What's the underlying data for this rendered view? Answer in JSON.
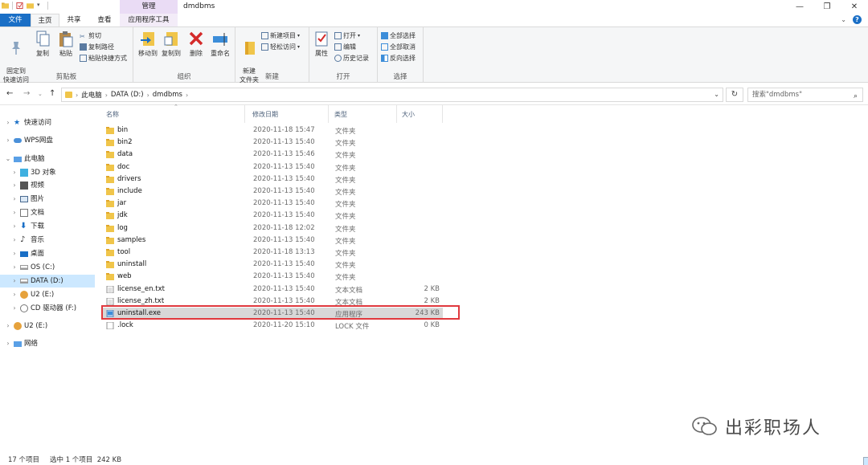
{
  "window": {
    "title": "dmdbms",
    "context_tab_header": "管理",
    "controls": [
      "—",
      "❐",
      "✕"
    ]
  },
  "tabs": {
    "file": "文件",
    "home": "主页",
    "share": "共享",
    "view": "查看",
    "app_tools": "应用程序工具"
  },
  "ribbon": {
    "clipboard": {
      "label": "剪贴板",
      "pin": "固定到\n快速访问",
      "copy": "复制",
      "paste": "粘贴",
      "cut": "剪切",
      "copy_path": "复制路径",
      "paste_shortcut": "粘贴快捷方式"
    },
    "organize": {
      "label": "组织",
      "move_to": "移动到",
      "copy_to": "复制到",
      "delete": "删除",
      "rename": "重命名"
    },
    "new": {
      "label": "新建",
      "new_folder": "新建\n文件夹",
      "new_item": "新建项目",
      "easy_access": "轻松访问"
    },
    "open": {
      "label": "打开",
      "properties": "属性",
      "open": "打开",
      "edit": "编辑",
      "history": "历史记录"
    },
    "select": {
      "label": "选择",
      "select_all": "全部选择",
      "select_none": "全部取消",
      "invert": "反向选择"
    }
  },
  "address": {
    "crumbs": [
      "此电脑",
      "DATA (D:)",
      "dmdbms"
    ],
    "search_placeholder": "搜索\"dmdbms\""
  },
  "nav": {
    "quick_access": "快速访问",
    "wps": "WPS网盘",
    "this_pc": "此电脑",
    "objects3d": "3D 对象",
    "videos": "视频",
    "pictures": "图片",
    "documents": "文档",
    "downloads": "下载",
    "music": "音乐",
    "desktop": "桌面",
    "os_c": "OS (C:)",
    "data_d": "DATA (D:)",
    "u2_e": "U2 (E:)",
    "cd_f": "CD 驱动器 (F:)",
    "u2_e2": "U2 (E:)",
    "network": "网络"
  },
  "columns": {
    "name": "名称",
    "date": "修改日期",
    "type": "类型",
    "size": "大小"
  },
  "files": [
    {
      "name": "bin",
      "date": "2020-11-18 15:47",
      "type": "文件夹",
      "size": "",
      "kind": "folder"
    },
    {
      "name": "bin2",
      "date": "2020-11-13 15:40",
      "type": "文件夹",
      "size": "",
      "kind": "folder"
    },
    {
      "name": "data",
      "date": "2020-11-13 15:46",
      "type": "文件夹",
      "size": "",
      "kind": "folder"
    },
    {
      "name": "doc",
      "date": "2020-11-13 15:40",
      "type": "文件夹",
      "size": "",
      "kind": "folder"
    },
    {
      "name": "drivers",
      "date": "2020-11-13 15:40",
      "type": "文件夹",
      "size": "",
      "kind": "folder"
    },
    {
      "name": "include",
      "date": "2020-11-13 15:40",
      "type": "文件夹",
      "size": "",
      "kind": "folder"
    },
    {
      "name": "jar",
      "date": "2020-11-13 15:40",
      "type": "文件夹",
      "size": "",
      "kind": "folder"
    },
    {
      "name": "jdk",
      "date": "2020-11-13 15:40",
      "type": "文件夹",
      "size": "",
      "kind": "folder"
    },
    {
      "name": "log",
      "date": "2020-11-18 12:02",
      "type": "文件夹",
      "size": "",
      "kind": "folder"
    },
    {
      "name": "samples",
      "date": "2020-11-13 15:40",
      "type": "文件夹",
      "size": "",
      "kind": "folder"
    },
    {
      "name": "tool",
      "date": "2020-11-18 13:13",
      "type": "文件夹",
      "size": "",
      "kind": "folder"
    },
    {
      "name": "uninstall",
      "date": "2020-11-13 15:40",
      "type": "文件夹",
      "size": "",
      "kind": "folder"
    },
    {
      "name": "web",
      "date": "2020-11-13 15:40",
      "type": "文件夹",
      "size": "",
      "kind": "folder"
    },
    {
      "name": "license_en.txt",
      "date": "2020-11-13 15:40",
      "type": "文本文档",
      "size": "2 KB",
      "kind": "text"
    },
    {
      "name": "license_zh.txt",
      "date": "2020-11-13 15:40",
      "type": "文本文档",
      "size": "2 KB",
      "kind": "text"
    },
    {
      "name": "uninstall.exe",
      "date": "2020-11-13 15:40",
      "type": "应用程序",
      "size": "243 KB",
      "kind": "exe"
    },
    {
      "name": ".lock",
      "date": "2020-11-20 15:10",
      "type": "LOCK 文件",
      "size": "0 KB",
      "kind": "blank"
    }
  ],
  "status": {
    "count": "17 个项目",
    "selected": "选中 1 个项目  242 KB"
  },
  "watermark": "出彩职场人",
  "colors": {
    "accent": "#1a6fc6",
    "selection": "#cce8ff",
    "highlight": "#e0393e",
    "folder": "#f0c54a"
  }
}
